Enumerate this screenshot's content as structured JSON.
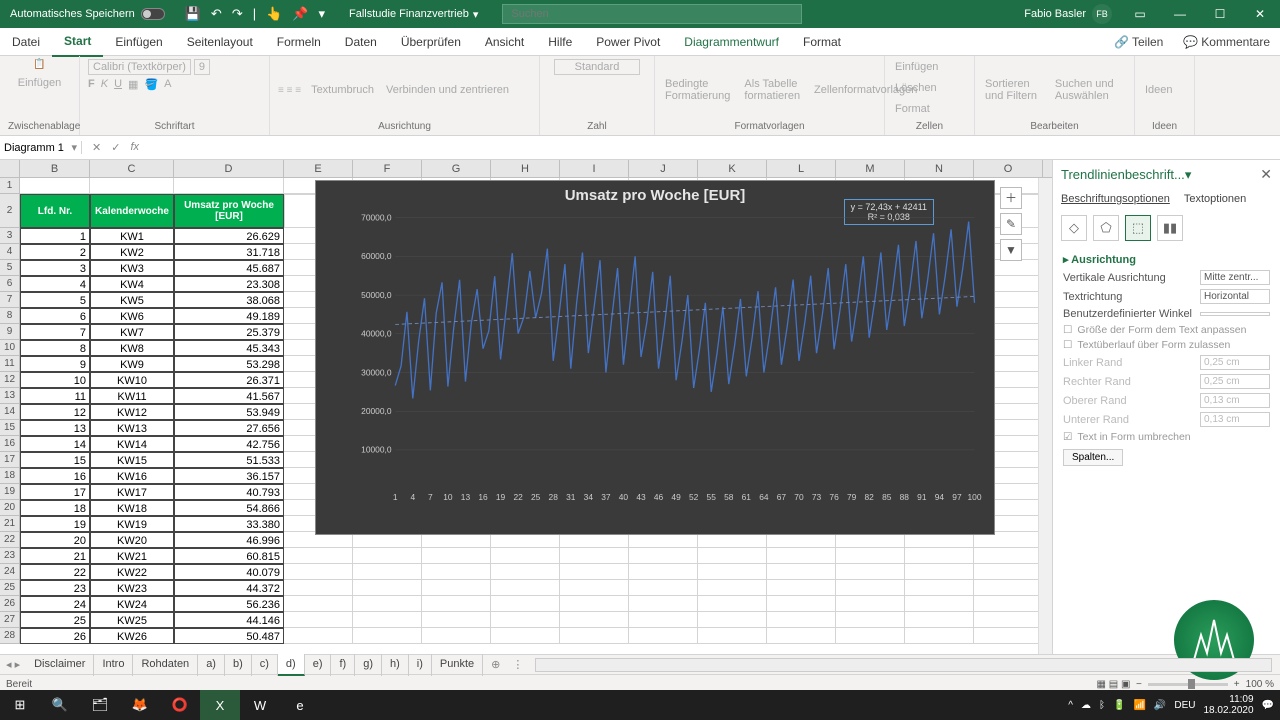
{
  "titlebar": {
    "autosave": "Automatisches Speichern",
    "docname": "Fallstudie Finanzvertrieb",
    "search_placeholder": "Suchen",
    "user": "Fabio Basler",
    "user_initials": "FB"
  },
  "tabs": {
    "datei": "Datei",
    "start": "Start",
    "einfuegen": "Einfügen",
    "seitenlayout": "Seitenlayout",
    "formeln": "Formeln",
    "daten": "Daten",
    "ueberpruefen": "Überprüfen",
    "ansicht": "Ansicht",
    "hilfe": "Hilfe",
    "powerpivot": "Power Pivot",
    "diagrammentwurf": "Diagrammentwurf",
    "format": "Format",
    "teilen": "Teilen",
    "kommentare": "Kommentare"
  },
  "ribbon": {
    "einfuegen": "Einfügen",
    "zwischenablage": "Zwischenablage",
    "schriftart": "Schriftart",
    "ausrichtung": "Ausrichtung",
    "textumbruch": "Textumbruch",
    "verbinden": "Verbinden und zentrieren",
    "zahl": "Zahl",
    "standard": "Standard",
    "bedingte": "Bedingte Formatierung",
    "alstabelle": "Als Tabelle formatieren",
    "zellenformat": "Zellenformatvorlagen",
    "formatvorlagen": "Formatvorlagen",
    "einf": "Einfügen",
    "loeschen": "Löschen",
    "format_btn": "Format",
    "zellen": "Zellen",
    "sortieren": "Sortieren und Filtern",
    "suchen": "Suchen und Auswählen",
    "bearbeiten": "Bearbeiten",
    "ideen": "Ideen",
    "font": "Calibri (Textkörper)",
    "fontsize": "9"
  },
  "namebox": "Diagramm 1",
  "fx": "fx",
  "columns": [
    "B",
    "C",
    "D",
    "E",
    "F",
    "G",
    "H",
    "I",
    "J",
    "K",
    "L",
    "M",
    "N",
    "O"
  ],
  "table": {
    "hdr_lfd": "Lfd. Nr.",
    "hdr_kw": "Kalenderwoche",
    "hdr_umsatz": "Umsatz pro Woche [EUR]",
    "rows": [
      {
        "n": 1,
        "kw": "KW1",
        "v": "26.629"
      },
      {
        "n": 2,
        "kw": "KW2",
        "v": "31.718"
      },
      {
        "n": 3,
        "kw": "KW3",
        "v": "45.687"
      },
      {
        "n": 4,
        "kw": "KW4",
        "v": "23.308"
      },
      {
        "n": 5,
        "kw": "KW5",
        "v": "38.068"
      },
      {
        "n": 6,
        "kw": "KW6",
        "v": "49.189"
      },
      {
        "n": 7,
        "kw": "KW7",
        "v": "25.379"
      },
      {
        "n": 8,
        "kw": "KW8",
        "v": "45.343"
      },
      {
        "n": 9,
        "kw": "KW9",
        "v": "53.298"
      },
      {
        "n": 10,
        "kw": "KW10",
        "v": "26.371"
      },
      {
        "n": 11,
        "kw": "KW11",
        "v": "41.567"
      },
      {
        "n": 12,
        "kw": "KW12",
        "v": "53.949"
      },
      {
        "n": 13,
        "kw": "KW13",
        "v": "27.656"
      },
      {
        "n": 14,
        "kw": "KW14",
        "v": "42.756"
      },
      {
        "n": 15,
        "kw": "KW15",
        "v": "51.533"
      },
      {
        "n": 16,
        "kw": "KW16",
        "v": "36.157"
      },
      {
        "n": 17,
        "kw": "KW17",
        "v": "40.793"
      },
      {
        "n": 18,
        "kw": "KW18",
        "v": "54.866"
      },
      {
        "n": 19,
        "kw": "KW19",
        "v": "33.380"
      },
      {
        "n": 20,
        "kw": "KW20",
        "v": "46.996"
      },
      {
        "n": 21,
        "kw": "KW21",
        "v": "60.815"
      },
      {
        "n": 22,
        "kw": "KW22",
        "v": "40.079"
      },
      {
        "n": 23,
        "kw": "KW23",
        "v": "44.372"
      },
      {
        "n": 24,
        "kw": "KW24",
        "v": "56.236"
      },
      {
        "n": 25,
        "kw": "KW25",
        "v": "44.146"
      },
      {
        "n": 26,
        "kw": "KW26",
        "v": "50.487"
      }
    ]
  },
  "chart_data": {
    "type": "line",
    "title": "Umsatz pro Woche [EUR]",
    "xlabel": "",
    "ylabel": "",
    "ylim": [
      0,
      70000
    ],
    "y_ticks": [
      "10000,0",
      "20000,0",
      "30000,0",
      "40000,0",
      "50000,0",
      "60000,0",
      "70000,0"
    ],
    "x_ticks": [
      1,
      4,
      7,
      10,
      13,
      16,
      19,
      22,
      25,
      28,
      31,
      34,
      37,
      40,
      43,
      46,
      49,
      52,
      55,
      58,
      61,
      64,
      67,
      70,
      73,
      76,
      79,
      82,
      85,
      88,
      91,
      94,
      97,
      100
    ],
    "trendline": {
      "equation": "y = 72,43x + 42411",
      "r2": "R² = 0,038",
      "slope": 72.43,
      "intercept": 42411
    },
    "series": [
      {
        "name": "Umsatz",
        "values": [
          26629,
          31718,
          45687,
          23308,
          38068,
          49189,
          25379,
          45343,
          53298,
          26371,
          41567,
          53949,
          27656,
          42756,
          51533,
          36157,
          40793,
          54866,
          33380,
          46996,
          60815,
          40079,
          44372,
          56236,
          44146,
          50487,
          62000,
          33000,
          45000,
          58000,
          31000,
          48000,
          61000,
          35000,
          47000,
          59000,
          30000,
          44000,
          57000,
          32000,
          46000,
          60000,
          34000,
          43000,
          56000,
          31000,
          42000,
          55000,
          28000,
          38000,
          50000,
          26000,
          36000,
          48000,
          25000,
          35000,
          47000,
          27000,
          37000,
          49000,
          29000,
          39000,
          51000,
          30000,
          40000,
          52000,
          32000,
          42000,
          54000,
          33000,
          43000,
          55000,
          35000,
          45000,
          57000,
          36000,
          46000,
          58000,
          38000,
          48000,
          60000,
          39000,
          49000,
          61000,
          41000,
          51000,
          63000,
          42000,
          52000,
          64000,
          44000,
          54000,
          66000,
          45000,
          55000,
          67000,
          47000,
          57000,
          69000,
          48000
        ]
      }
    ]
  },
  "sidepane": {
    "title": "Trendlinienbeschrift...",
    "opt1": "Beschriftungsoptionen",
    "opt2": "Textoptionen",
    "sect": "Ausrichtung",
    "vert": "Vertikale Ausrichtung",
    "vert_val": "Mitte zentr...",
    "textdir": "Textrichtung",
    "textdir_val": "Horizontal",
    "angle": "Benutzerdefinierter Winkel",
    "fit": "Größe der Form dem Text anpassen",
    "overflow": "Textüberlauf über Form zulassen",
    "left": "Linker Rand",
    "right": "Rechter Rand",
    "top": "Oberer Rand",
    "bottom": "Unterer Rand",
    "m1": "0,25 cm",
    "m2": "0,25 cm",
    "m3": "0,13 cm",
    "m4": "0,13 cm",
    "wrap": "Text in Form umbrechen",
    "cols": "Spalten..."
  },
  "sheets": [
    "Disclaimer",
    "Intro",
    "Rohdaten",
    "a)",
    "b)",
    "c)",
    "d)",
    "e)",
    "f)",
    "g)",
    "h)",
    "i)",
    "Punkte"
  ],
  "active_sheet": "d)",
  "status": {
    "ready": "Bereit",
    "zoom": "100 %",
    "avg": "",
    "lang": "DEU"
  },
  "clock": {
    "time": "11:09",
    "date": "18.02.2020"
  }
}
